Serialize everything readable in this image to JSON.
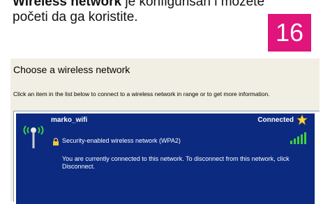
{
  "document": {
    "line1_bold": "Wireless network",
    "line1_rest": " je konfigurisan i možete",
    "line2": "početi  da ga koristite.",
    "step_number": "16",
    "badge_color": "#e0147a"
  },
  "dialog": {
    "title": "Choose a wireless network",
    "description": "Click an item in the list below to connect to a wireless network in range or to get more information."
  },
  "network": {
    "name": "marko_wifi",
    "status": "Connected",
    "security": "Security-enabled wireless network (WPA2)",
    "message": "You are currently connected to this network. To disconnect from this network, click Disconnect.",
    "icons": [
      "wireless-antenna-icon",
      "star-icon",
      "lock-icon",
      "signal-strength-icon"
    ],
    "selection_color": "#0b2a80",
    "signal_color": "#3fd23f"
  }
}
